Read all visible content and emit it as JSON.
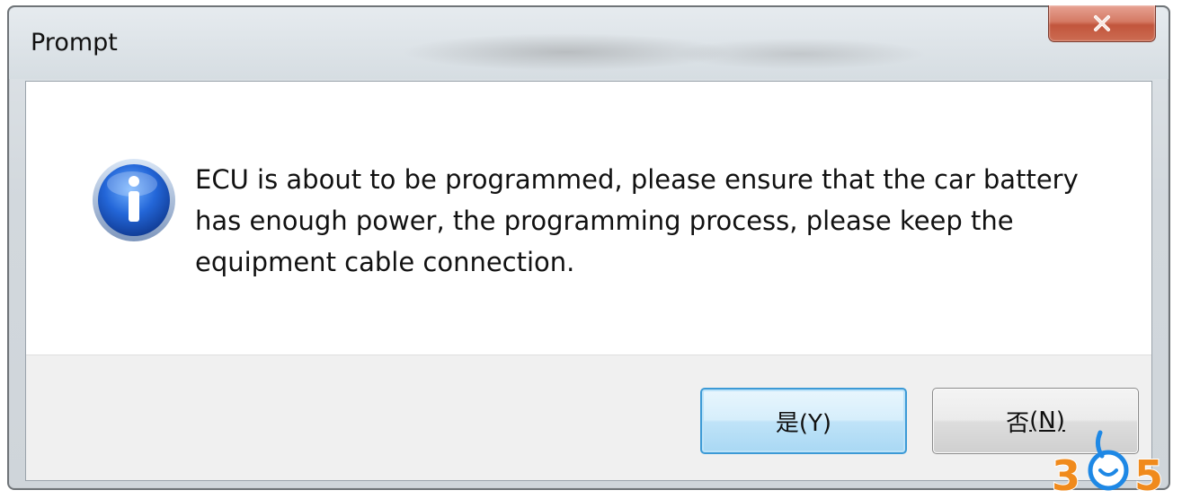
{
  "window": {
    "title": "Prompt"
  },
  "dialog": {
    "icon": "info-icon",
    "message": "ECU is about to be programmed, please ensure that the car battery has enough power, the programming process, please keep the equipment cable connection."
  },
  "buttons": {
    "yes_label": "是(Y)",
    "no_label": "否",
    "no_mnemonic": "(N)"
  },
  "titlebar": {
    "close_icon": "close-icon"
  },
  "watermark": {
    "text": "365",
    "color": "#f08a1c"
  },
  "colors": {
    "accent_button_border": "#3c9ad6",
    "close_button": "#c2553c",
    "info_icon_blue": "#1f5fc8"
  }
}
